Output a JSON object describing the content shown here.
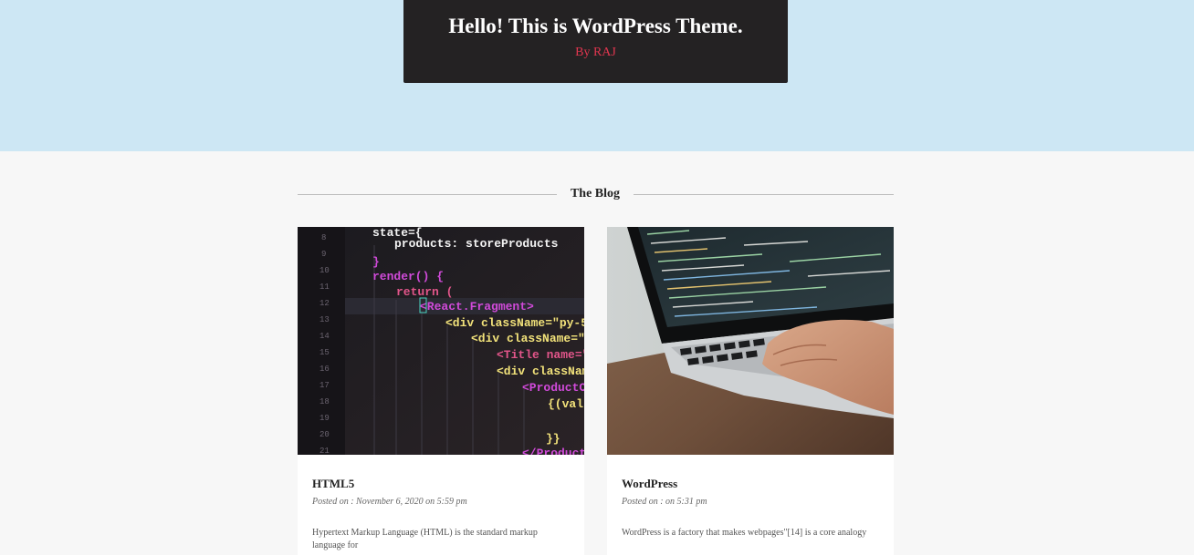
{
  "header": {
    "title": "Hello! This is WordPress Theme.",
    "byline": "By RAJ"
  },
  "blog": {
    "heading": "The Blog",
    "posts": [
      {
        "title": "HTML5",
        "meta": "Posted on : November 6, 2020 on 5:59 pm",
        "excerpt": "Hypertext Markup Language (HTML) is the standard markup language for",
        "image": "code-editor-photo",
        "code_lines": [
          "state={",
          "products: storeProducts",
          "}",
          "render() {",
          "return (",
          "<React.Fragment>",
          "<div className=\"py-5",
          "<div className=\"c",
          "<Title name=\"",
          "<div classNam",
          "<ProductC",
          "{(val",
          "}}",
          "</Product"
        ]
      },
      {
        "title": "WordPress",
        "meta": "Posted on : on 5:31 pm",
        "excerpt": "WordPress is a factory that makes webpages\"[14] is a core analogy",
        "image": "laptop-typing-photo"
      }
    ]
  },
  "colors": {
    "hero_bg": "#cde7f4",
    "title_box_bg": "#242223",
    "byline": "#e0364f",
    "page_bg": "#f7f7f7"
  }
}
